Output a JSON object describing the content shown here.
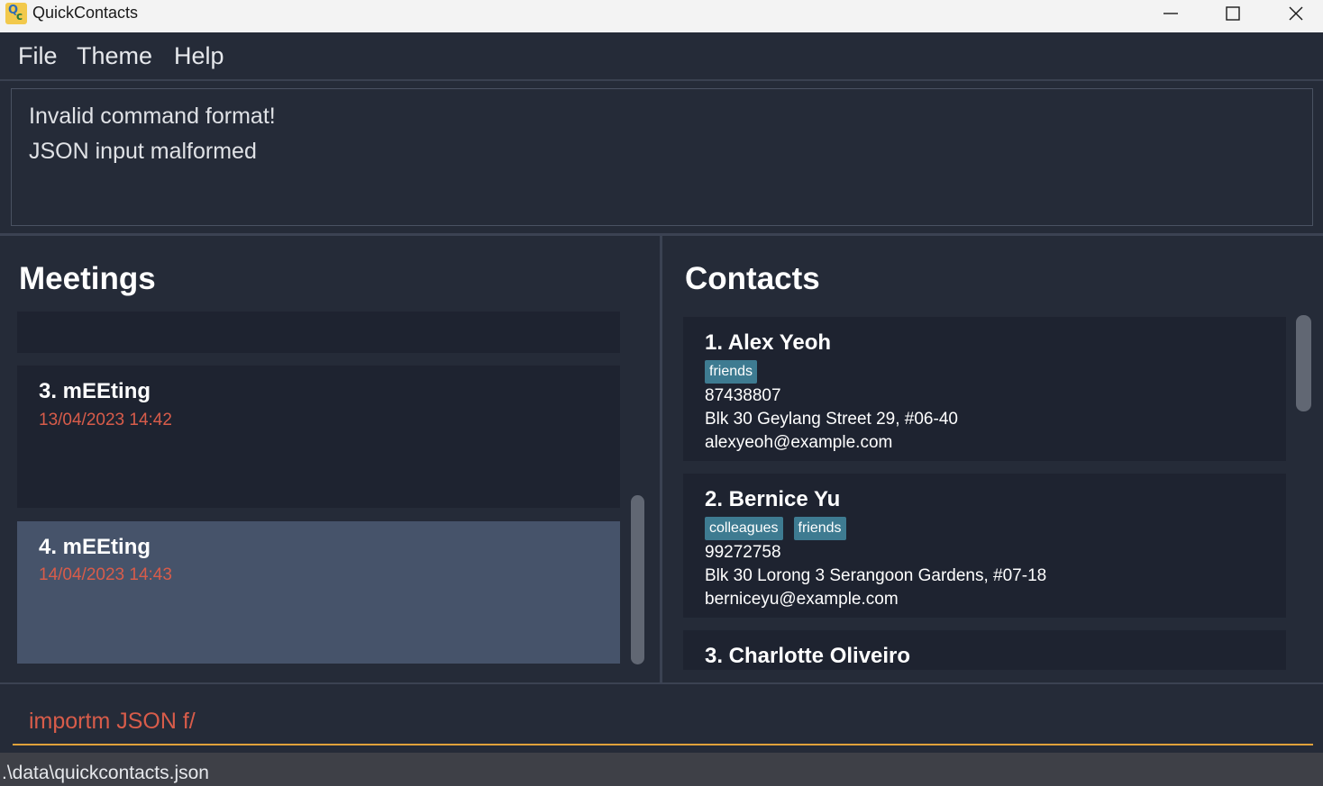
{
  "window": {
    "title": "QuickContacts"
  },
  "menu": {
    "file": "File",
    "theme": "Theme",
    "help": "Help"
  },
  "result": {
    "lines": [
      "Invalid command format!",
      "JSON input malformed"
    ]
  },
  "meetings": {
    "heading": "Meetings",
    "items": [
      {
        "name": "3.  mEEting",
        "date": "13/04/2023 14:42",
        "selected": false
      },
      {
        "name": "4.  mEEting",
        "date": "14/04/2023 14:43",
        "selected": true
      }
    ]
  },
  "contacts": {
    "heading": "Contacts",
    "items": [
      {
        "name": "1.  Alex Yeoh",
        "tags": [
          "friends"
        ],
        "phone": "87438807",
        "address": "Blk 30 Geylang Street 29, #06-40",
        "email": "alexyeoh@example.com"
      },
      {
        "name": "2.  Bernice Yu",
        "tags": [
          "colleagues",
          "friends"
        ],
        "phone": "99272758",
        "address": "Blk 30 Lorong 3 Serangoon Gardens, #07-18",
        "email": "berniceyu@example.com"
      },
      {
        "name": "3.  Charlotte Oliveiro"
      }
    ]
  },
  "command": {
    "value": "importm JSON f/"
  },
  "status": {
    "path": ".\\data\\quickcontacts.json"
  },
  "colors": {
    "background": "#252b38",
    "card": "#1e2330",
    "selected_card": "#46536a",
    "tag": "#3e7b91",
    "date": "#d85c4a",
    "command_underline": "#e0a23b"
  }
}
